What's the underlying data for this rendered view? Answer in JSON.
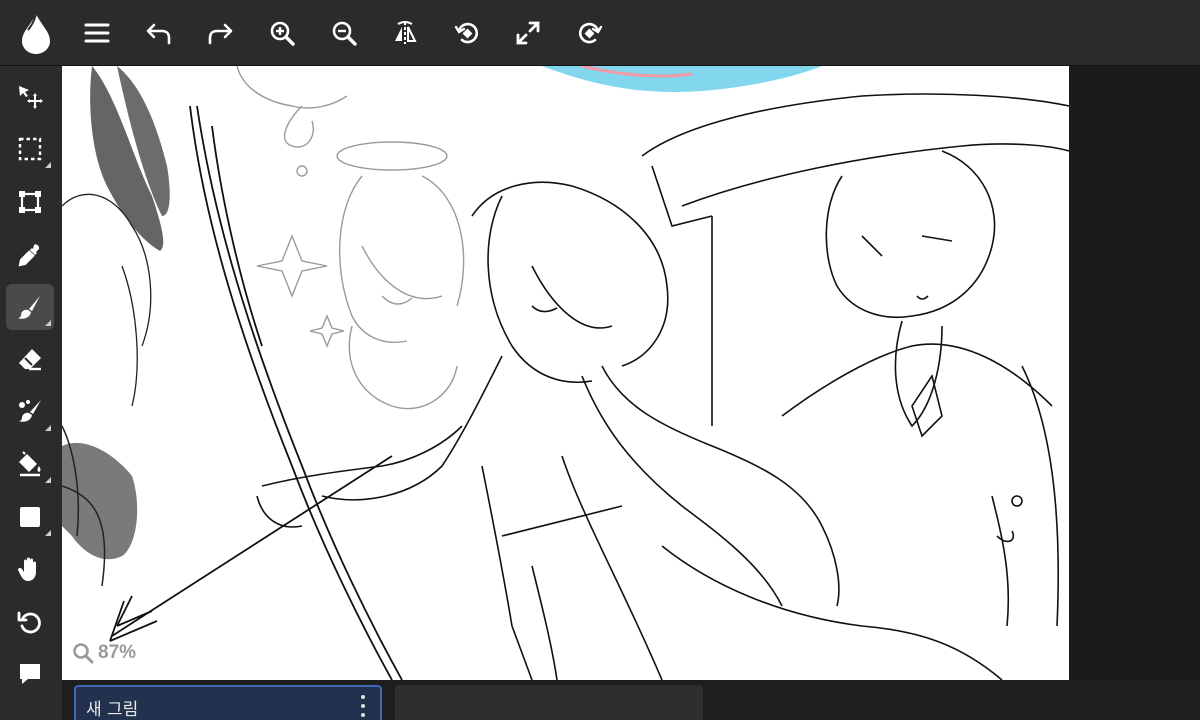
{
  "toolbar": {
    "buttons": [
      "menu",
      "undo",
      "redo",
      "zoom-in",
      "zoom-out",
      "flip",
      "rotate-left",
      "fullscreen",
      "rotate-right"
    ]
  },
  "tools": [
    "move",
    "select",
    "transform",
    "eyedropper",
    "brush",
    "eraser",
    "smudge",
    "fill",
    "shape",
    "hand",
    "history",
    "comment"
  ],
  "active_tool": "brush",
  "canvas": {
    "zoom_label": "87%"
  },
  "layers": {
    "current_name": "새 그림"
  },
  "colors": {
    "panel": "#2b2b2b",
    "accent": "#3d6ab3",
    "layer_bg": "#22324e"
  }
}
